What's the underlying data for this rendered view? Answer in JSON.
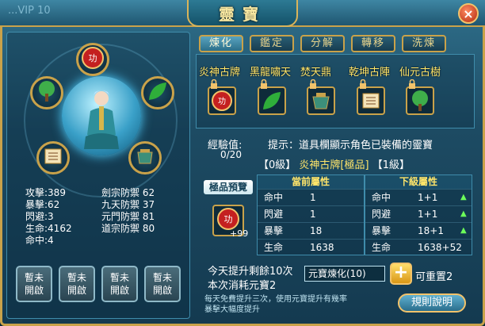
{
  "header": {
    "vip_text": "...VIP 10",
    "title": "靈寶",
    "close_label": "×"
  },
  "character": {
    "stats_left": [
      {
        "label": "攻擊:",
        "value": "389"
      },
      {
        "label": "暴擊:",
        "value": "62"
      },
      {
        "label": "閃避:",
        "value": "3"
      },
      {
        "label": "生命:",
        "value": "4162"
      },
      {
        "label": "命中:",
        "value": "4"
      }
    ],
    "stats_right": [
      {
        "label": "劍宗防禦",
        "value": "62"
      },
      {
        "label": "九天防禦",
        "value": "37"
      },
      {
        "label": "元門防禦",
        "value": "81"
      },
      {
        "label": "道宗防禦",
        "value": "80"
      }
    ],
    "locked_slots": [
      {
        "label": "暫未\n開啟"
      },
      {
        "label": "暫未\n開啟"
      },
      {
        "label": "暫未\n開啟"
      },
      {
        "label": "暫未\n開啟"
      }
    ]
  },
  "tabs": [
    {
      "label": "煉化",
      "active": true
    },
    {
      "label": "鑑定",
      "active": false
    },
    {
      "label": "分解",
      "active": false
    },
    {
      "label": "轉移",
      "active": false
    },
    {
      "label": "洗煉",
      "active": false
    }
  ],
  "items": [
    {
      "name": "炎神古牌",
      "icon": "seal-red-icon"
    },
    {
      "name": "黑龍嘯天",
      "icon": "green-leaf-icon"
    },
    {
      "name": "焚天鼎",
      "icon": "cauldron-icon"
    },
    {
      "name": "乾坤古陣",
      "icon": "scroll-icon"
    },
    {
      "name": "仙元古樹",
      "icon": "tree-icon"
    }
  ],
  "experience": {
    "label": "經驗值:",
    "value": "0/20"
  },
  "hint": "提示：道具欄顯示角色已裝備的靈寶",
  "selected": {
    "level_prefix": "【0級】",
    "name": "炎神古牌[極品]",
    "level_suffix": "【1級】"
  },
  "preview": {
    "label": "極品預覽",
    "count": "+99"
  },
  "current_attrs": {
    "title": "當前屬性",
    "rows": [
      {
        "name": "命中",
        "value": "1"
      },
      {
        "name": "閃避",
        "value": "1"
      },
      {
        "name": "暴擊",
        "value": "18"
      },
      {
        "name": "生命",
        "value": "1638"
      }
    ]
  },
  "next_attrs": {
    "title": "下級屬性",
    "rows": [
      {
        "name": "命中",
        "value": "1+1"
      },
      {
        "name": "閃避",
        "value": "1+1"
      },
      {
        "name": "暴擊",
        "value": "18+1"
      },
      {
        "name": "生命",
        "value": "1638+52"
      }
    ]
  },
  "refine": {
    "today_text": "今天提升剩餘10次",
    "cost_text": "本次消耗元寶2",
    "method": "元寶煉化(10)",
    "reset_text": "可重置2",
    "note_line1": "每天免費提升三次，使用元寶提升有幾率",
    "note_line2": "暴擊大幅度提升",
    "rules_button": "規則說明"
  },
  "colors": {
    "gold": "#c9a24a",
    "highlight": "#ffe56a",
    "up_arrow": "#6cff5a"
  }
}
